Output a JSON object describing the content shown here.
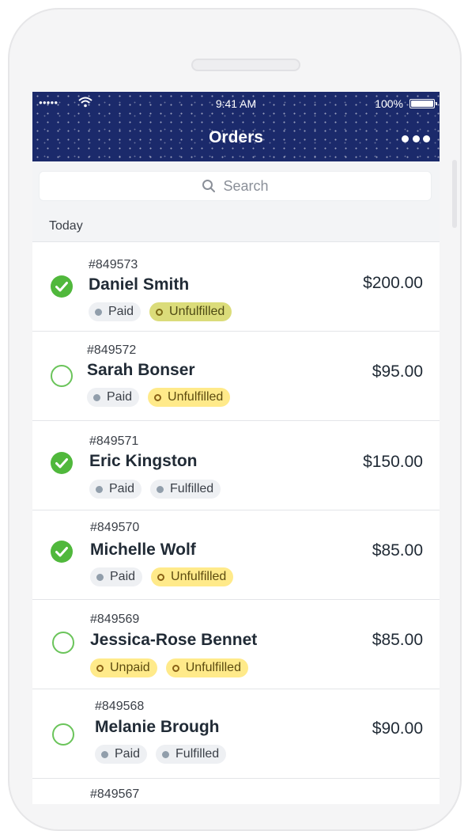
{
  "status_bar": {
    "signal": "●●●●●",
    "time": "9:41 AM",
    "battery": "100%"
  },
  "header": {
    "title": "Orders",
    "more_icon": "more-horizontal-icon"
  },
  "search": {
    "placeholder": "Search",
    "icon": "search-icon"
  },
  "section": {
    "label": "Today"
  },
  "orders": [
    {
      "number": "#849573",
      "customer": "Daniel Smith",
      "total": "$200.00",
      "checked": true,
      "payment": "Paid",
      "fulfillment": "Unfulfilled"
    },
    {
      "number": "#849572",
      "customer": "Sarah Bonser",
      "total": "$95.00",
      "checked": false,
      "payment": "Paid",
      "fulfillment": "Unfulfilled"
    },
    {
      "number": "#849571",
      "customer": "Eric Kingston",
      "total": "$150.00",
      "checked": true,
      "payment": "Paid",
      "fulfillment": "Fulfilled"
    },
    {
      "number": "#849570",
      "customer": "Michelle Wolf",
      "total": "$85.00",
      "checked": true,
      "payment": "Paid",
      "fulfillment": "Unfulfilled"
    },
    {
      "number": "#849569",
      "customer": "Jessica-Rose Bennet",
      "total": "$85.00",
      "checked": false,
      "payment": "Unpaid",
      "fulfillment": "Unfulfilled"
    },
    {
      "number": "#849568",
      "customer": "Melanie Brough",
      "total": "$90.00",
      "checked": false,
      "payment": "Paid",
      "fulfillment": "Fulfilled"
    }
  ],
  "partial_next_order": {
    "number": "#849567"
  },
  "colors": {
    "header_bg": "#1b2a6b",
    "check_green": "#50b83c",
    "badge_attention": "#ffea8a",
    "badge_neutral": "#eef0f3"
  }
}
